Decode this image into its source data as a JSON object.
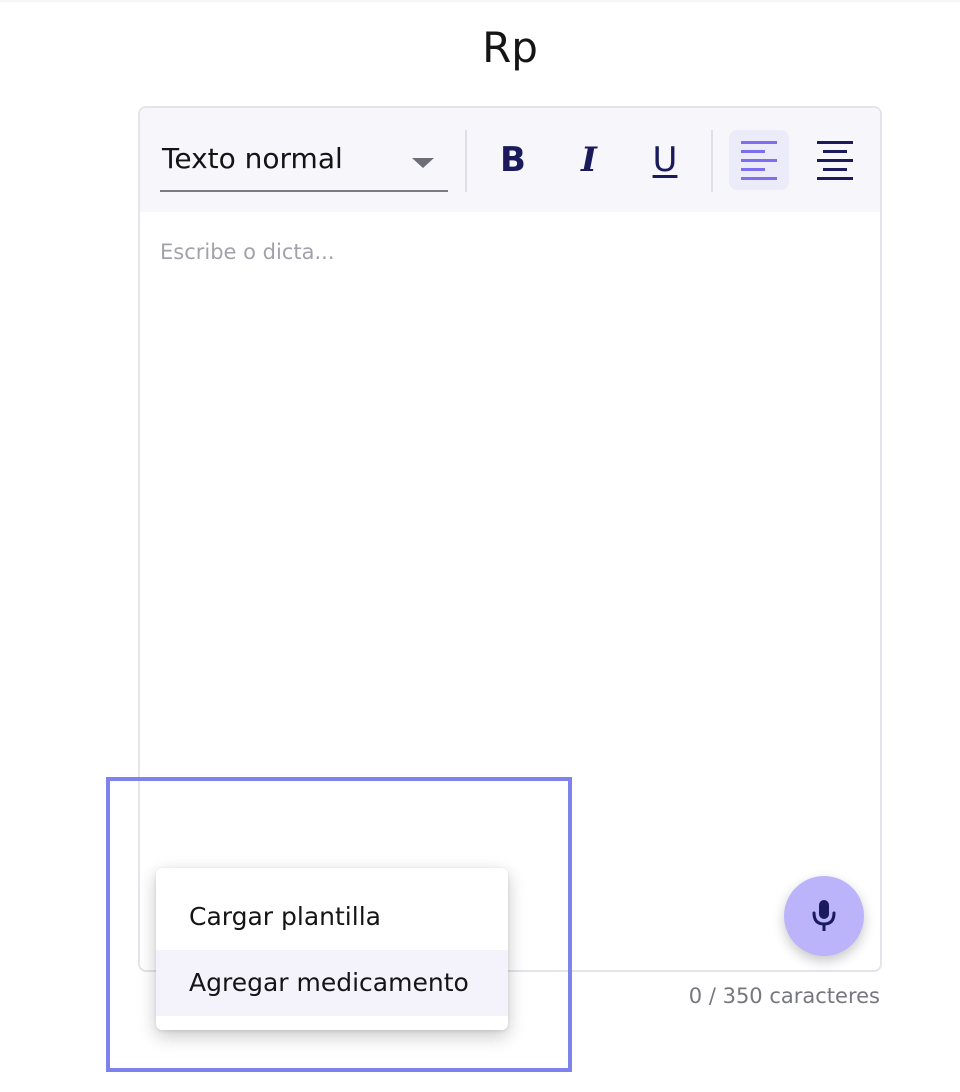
{
  "header": {
    "title": "Rp"
  },
  "toolbar": {
    "text_style": {
      "value": "Texto normal"
    },
    "buttons": [
      {
        "name": "bold",
        "glyph": "B"
      },
      {
        "name": "italic",
        "glyph": "I"
      },
      {
        "name": "underline",
        "glyph": "U"
      },
      {
        "name": "align-left",
        "active": true
      },
      {
        "name": "align-center",
        "active": false
      }
    ]
  },
  "editor": {
    "placeholder": "Escribe o dicta..."
  },
  "mic_button": {
    "icon": "microphone-icon"
  },
  "counter": {
    "text": "0 / 350 caracteres"
  },
  "menu": {
    "items": [
      {
        "label": "Cargar plantilla"
      },
      {
        "label": "Agregar medicamento"
      }
    ]
  },
  "colors": {
    "accent": "#7d82ec",
    "fab": "#bcb4fb",
    "icon_dark": "#1a1a5c",
    "align_active": "#7b6ff0",
    "toolbar_bg": "#f6f6fb"
  }
}
